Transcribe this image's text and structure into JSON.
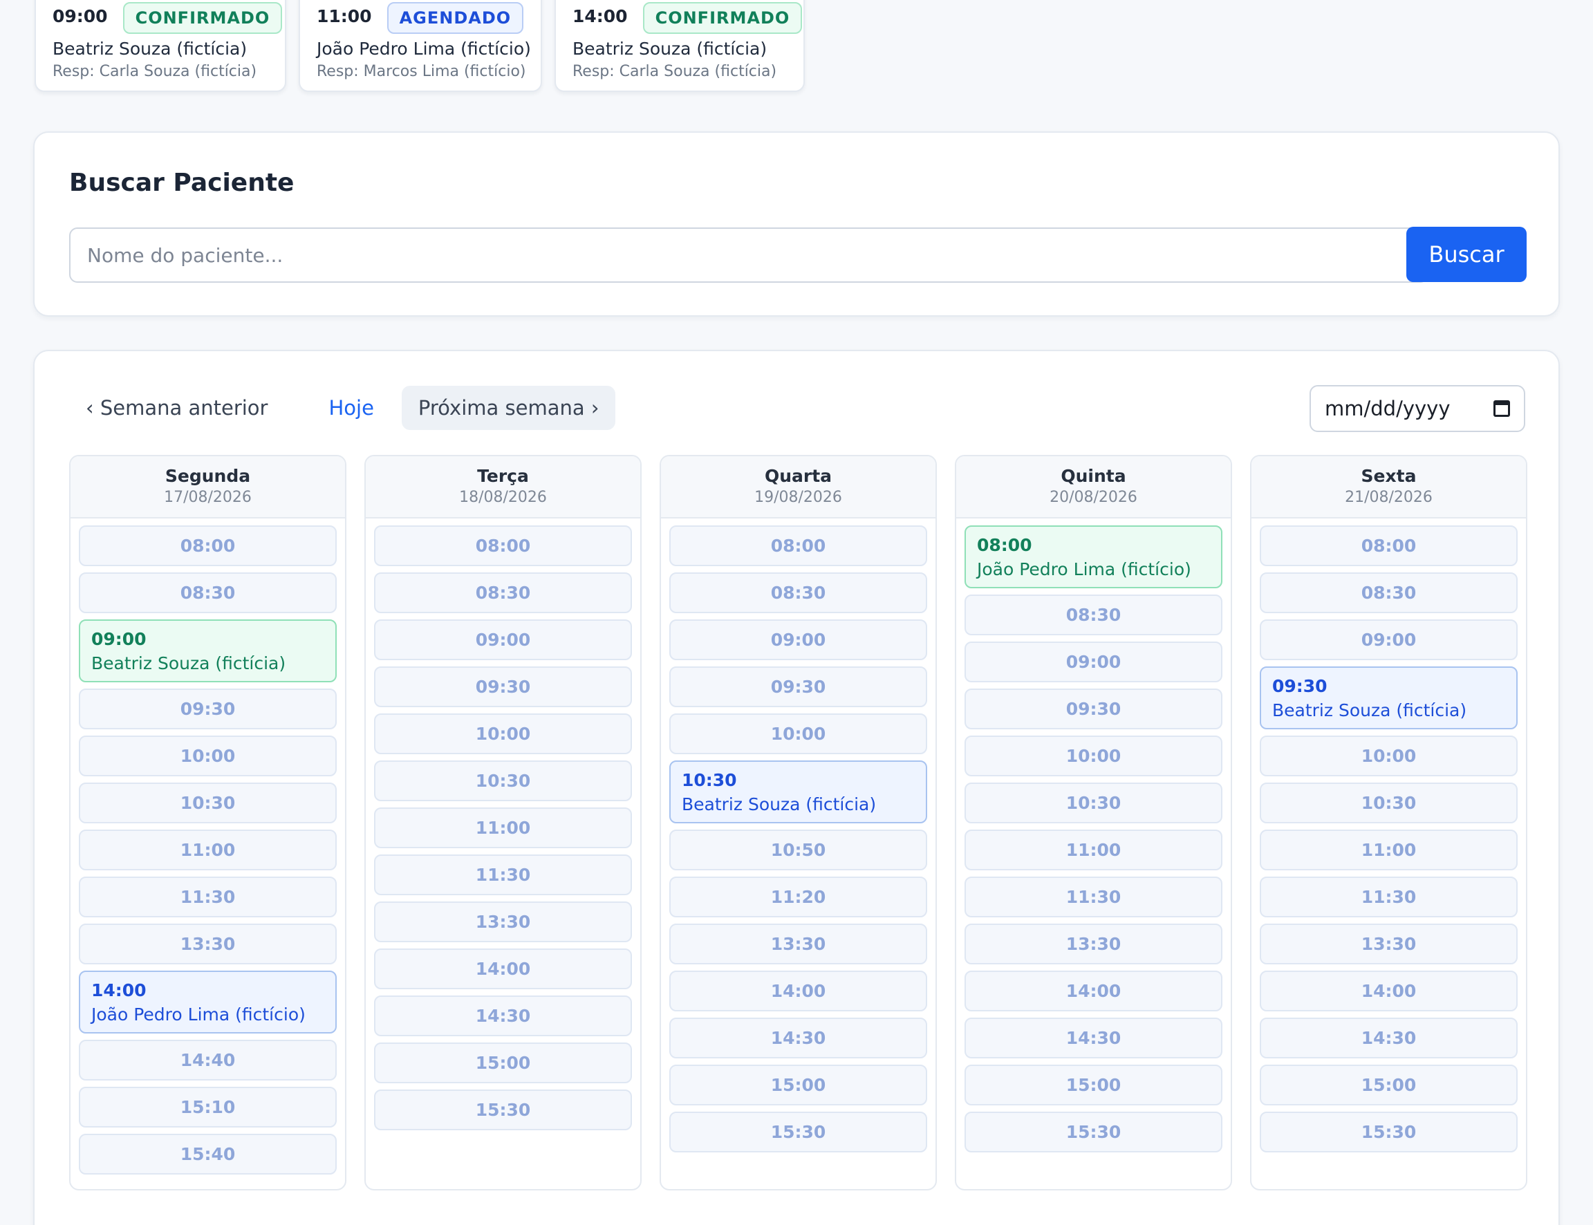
{
  "today": {
    "cards": [
      {
        "time": "09:00",
        "status": "CONFIRMADO",
        "status_kind": "confirmado",
        "patient": "Beatriz Souza (fictícia)",
        "resp": "Resp: Carla Souza (fictícia)"
      },
      {
        "time": "11:00",
        "status": "AGENDADO",
        "status_kind": "agendado",
        "patient": "João Pedro Lima (fictício)",
        "resp": "Resp: Marcos Lima (fictício)"
      },
      {
        "time": "14:00",
        "status": "CONFIRMADO",
        "status_kind": "confirmado",
        "patient": "Beatriz Souza (fictícia)",
        "resp": "Resp: Carla Souza (fictícia)"
      }
    ]
  },
  "search": {
    "title": "Buscar Paciente",
    "placeholder": "Nome do paciente...",
    "button": "Buscar"
  },
  "calendar": {
    "prev": "‹ Semana anterior",
    "today": "Hoje",
    "next": "Próxima semana ›",
    "date_placeholder": "mm/dd/yyyy",
    "days": [
      {
        "name": "Segunda",
        "date": "17/08/2026",
        "slots": [
          {
            "time": "08:00"
          },
          {
            "time": "08:30"
          },
          {
            "time": "09:00",
            "patient": "Beatriz Souza (fictícia)",
            "kind": "green"
          },
          {
            "time": "09:30"
          },
          {
            "time": "10:00"
          },
          {
            "time": "10:30"
          },
          {
            "time": "11:00"
          },
          {
            "time": "11:30"
          },
          {
            "time": "13:30"
          },
          {
            "time": "14:00",
            "patient": "João Pedro Lima (fictício)",
            "kind": "blue"
          },
          {
            "time": "14:40"
          },
          {
            "time": "15:10"
          },
          {
            "time": "15:40"
          }
        ]
      },
      {
        "name": "Terça",
        "date": "18/08/2026",
        "slots": [
          {
            "time": "08:00"
          },
          {
            "time": "08:30"
          },
          {
            "time": "09:00"
          },
          {
            "time": "09:30"
          },
          {
            "time": "10:00"
          },
          {
            "time": "10:30"
          },
          {
            "time": "11:00"
          },
          {
            "time": "11:30"
          },
          {
            "time": "13:30"
          },
          {
            "time": "14:00"
          },
          {
            "time": "14:30"
          },
          {
            "time": "15:00"
          },
          {
            "time": "15:30"
          }
        ]
      },
      {
        "name": "Quarta",
        "date": "19/08/2026",
        "slots": [
          {
            "time": "08:00"
          },
          {
            "time": "08:30"
          },
          {
            "time": "09:00"
          },
          {
            "time": "09:30"
          },
          {
            "time": "10:00"
          },
          {
            "time": "10:30",
            "patient": "Beatriz Souza (fictícia)",
            "kind": "blue"
          },
          {
            "time": "10:50"
          },
          {
            "time": "11:20"
          },
          {
            "time": "13:30"
          },
          {
            "time": "14:00"
          },
          {
            "time": "14:30"
          },
          {
            "time": "15:00"
          },
          {
            "time": "15:30"
          }
        ]
      },
      {
        "name": "Quinta",
        "date": "20/08/2026",
        "slots": [
          {
            "time": "08:00",
            "patient": "João Pedro Lima (fictício)",
            "kind": "green"
          },
          {
            "time": "08:30"
          },
          {
            "time": "09:00"
          },
          {
            "time": "09:30"
          },
          {
            "time": "10:00"
          },
          {
            "time": "10:30"
          },
          {
            "time": "11:00"
          },
          {
            "time": "11:30"
          },
          {
            "time": "13:30"
          },
          {
            "time": "14:00"
          },
          {
            "time": "14:30"
          },
          {
            "time": "15:00"
          },
          {
            "time": "15:30"
          }
        ]
      },
      {
        "name": "Sexta",
        "date": "21/08/2026",
        "slots": [
          {
            "time": "08:00"
          },
          {
            "time": "08:30"
          },
          {
            "time": "09:00"
          },
          {
            "time": "09:30",
            "patient": "Beatriz Souza (fictícia)",
            "kind": "blue"
          },
          {
            "time": "10:00"
          },
          {
            "time": "10:30"
          },
          {
            "time": "11:00"
          },
          {
            "time": "11:30"
          },
          {
            "time": "13:30"
          },
          {
            "time": "14:00"
          },
          {
            "time": "14:30"
          },
          {
            "time": "15:00"
          },
          {
            "time": "15:30"
          }
        ]
      }
    ]
  }
}
